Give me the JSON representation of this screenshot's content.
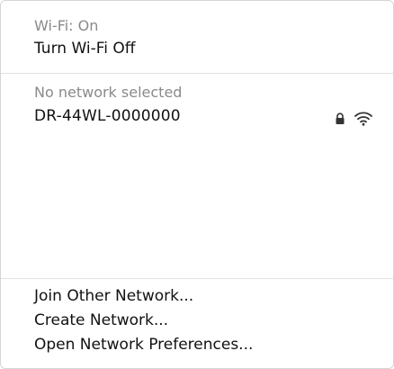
{
  "wifi_menu": {
    "status_text": "Wi-Fi: On",
    "toggle_label": "Turn Wi-Fi Off",
    "selection_status": "No network selected",
    "networks": [
      {
        "name": "DR-44WL-0000000",
        "locked": true,
        "icons": [
          "lock-icon",
          "wifi-signal-icon"
        ]
      }
    ],
    "actions": {
      "join_other": "Join Other Network...",
      "create": "Create Network...",
      "open_prefs": "Open Network Preferences..."
    }
  }
}
